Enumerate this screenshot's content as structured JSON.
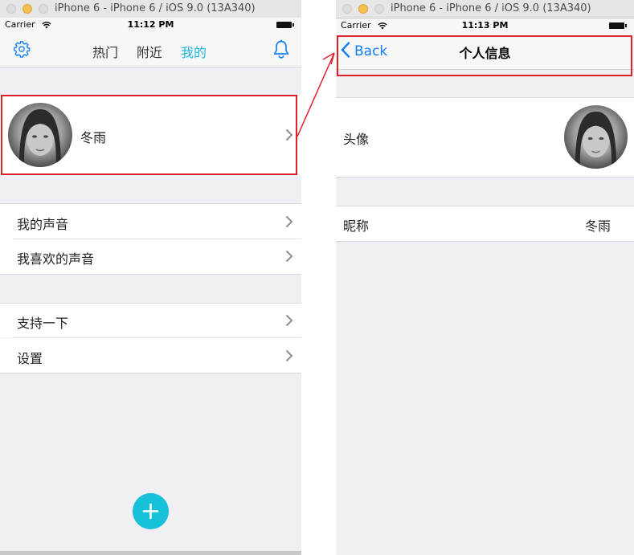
{
  "left": {
    "window_title": "iPhone 6 - iPhone 6 / iOS 9.0 (13A340)",
    "status": {
      "carrier": "Carrier",
      "time": "11:12 PM"
    },
    "nav": {
      "tabs": [
        {
          "label": "热门",
          "active": false
        },
        {
          "label": "附近",
          "active": false
        },
        {
          "label": "我的",
          "active": true
        }
      ],
      "left_icon": "gear-icon",
      "right_icon": "bell-icon"
    },
    "profile": {
      "name": "冬雨"
    },
    "group1": [
      {
        "label": "我的声音"
      },
      {
        "label": "我喜欢的声音"
      }
    ],
    "group2": [
      {
        "label": "支持一下"
      },
      {
        "label": "设置"
      }
    ],
    "fab_icon": "plus-icon"
  },
  "right": {
    "window_title": "iPhone 6 - iPhone 6 / iOS 9.0 (13A340)",
    "status": {
      "carrier": "Carrier",
      "time": "11:13 PM"
    },
    "nav": {
      "back_label": "Back",
      "title": "个人信息"
    },
    "rows": [
      {
        "label": "头像"
      },
      {
        "label": "昵称",
        "value": "冬雨"
      }
    ]
  },
  "colors": {
    "accent": "#1eb6dc",
    "link_blue": "#147efb",
    "fab": "#17c1d9",
    "highlight": "#e0202c",
    "background": "#efeff4"
  }
}
